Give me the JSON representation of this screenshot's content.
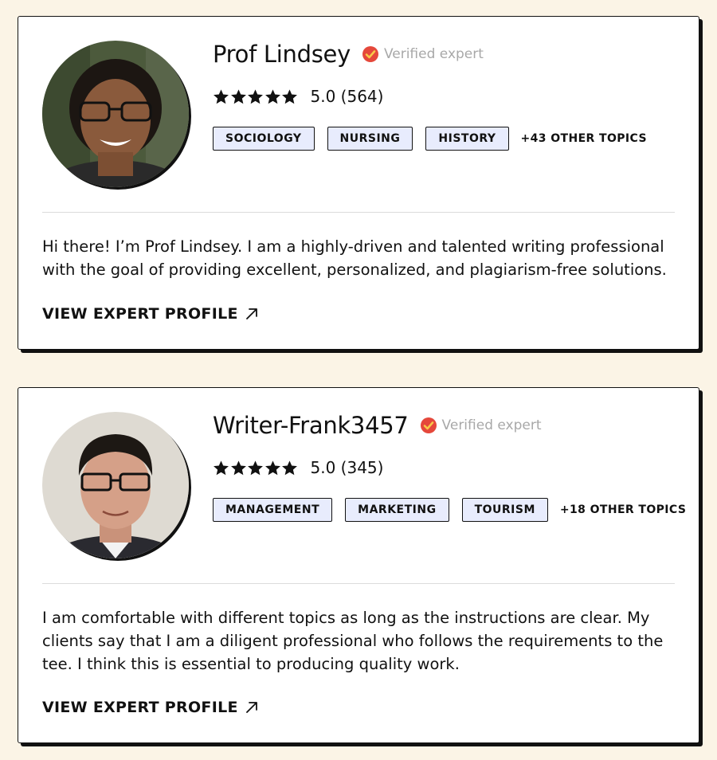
{
  "experts": [
    {
      "name": "Prof Lindsey",
      "verified_label": "Verified expert",
      "rating_text": "5.0 (564)",
      "rating": 5,
      "tags": [
        "SOCIOLOGY",
        "NURSING",
        "HISTORY"
      ],
      "other_topics": "+43 OTHER TOPICS",
      "bio": "Hi there! I’m Prof Lindsey. I am a highly-driven and talented writing professional with the goal of providing excellent, personalized, and plagiarism-free solutions.",
      "link_label": "VIEW EXPERT PROFILE"
    },
    {
      "name": "Writer-Frank3457",
      "verified_label": "Verified expert",
      "rating_text": "5.0 (345)",
      "rating": 5,
      "tags": [
        "MANAGEMENT",
        "MARKETING",
        "TOURISM"
      ],
      "other_topics": "+18 OTHER TOPICS",
      "bio": "I am comfortable with different topics as long as the instructions are clear. My clients say that I am a diligent professional who follows the requirements to the tee. I think this is essential to producing quality work.",
      "link_label": "VIEW EXPERT PROFILE"
    }
  ],
  "colors": {
    "page_background": "#fbf4e6",
    "tag_background": "#e8ecfd",
    "verified_badge": "#e5483b",
    "verified_text": "#a8a8a8"
  },
  "icons": {
    "verified": "verified-check-icon",
    "star": "star-icon",
    "link": "arrow-up-right-icon"
  }
}
